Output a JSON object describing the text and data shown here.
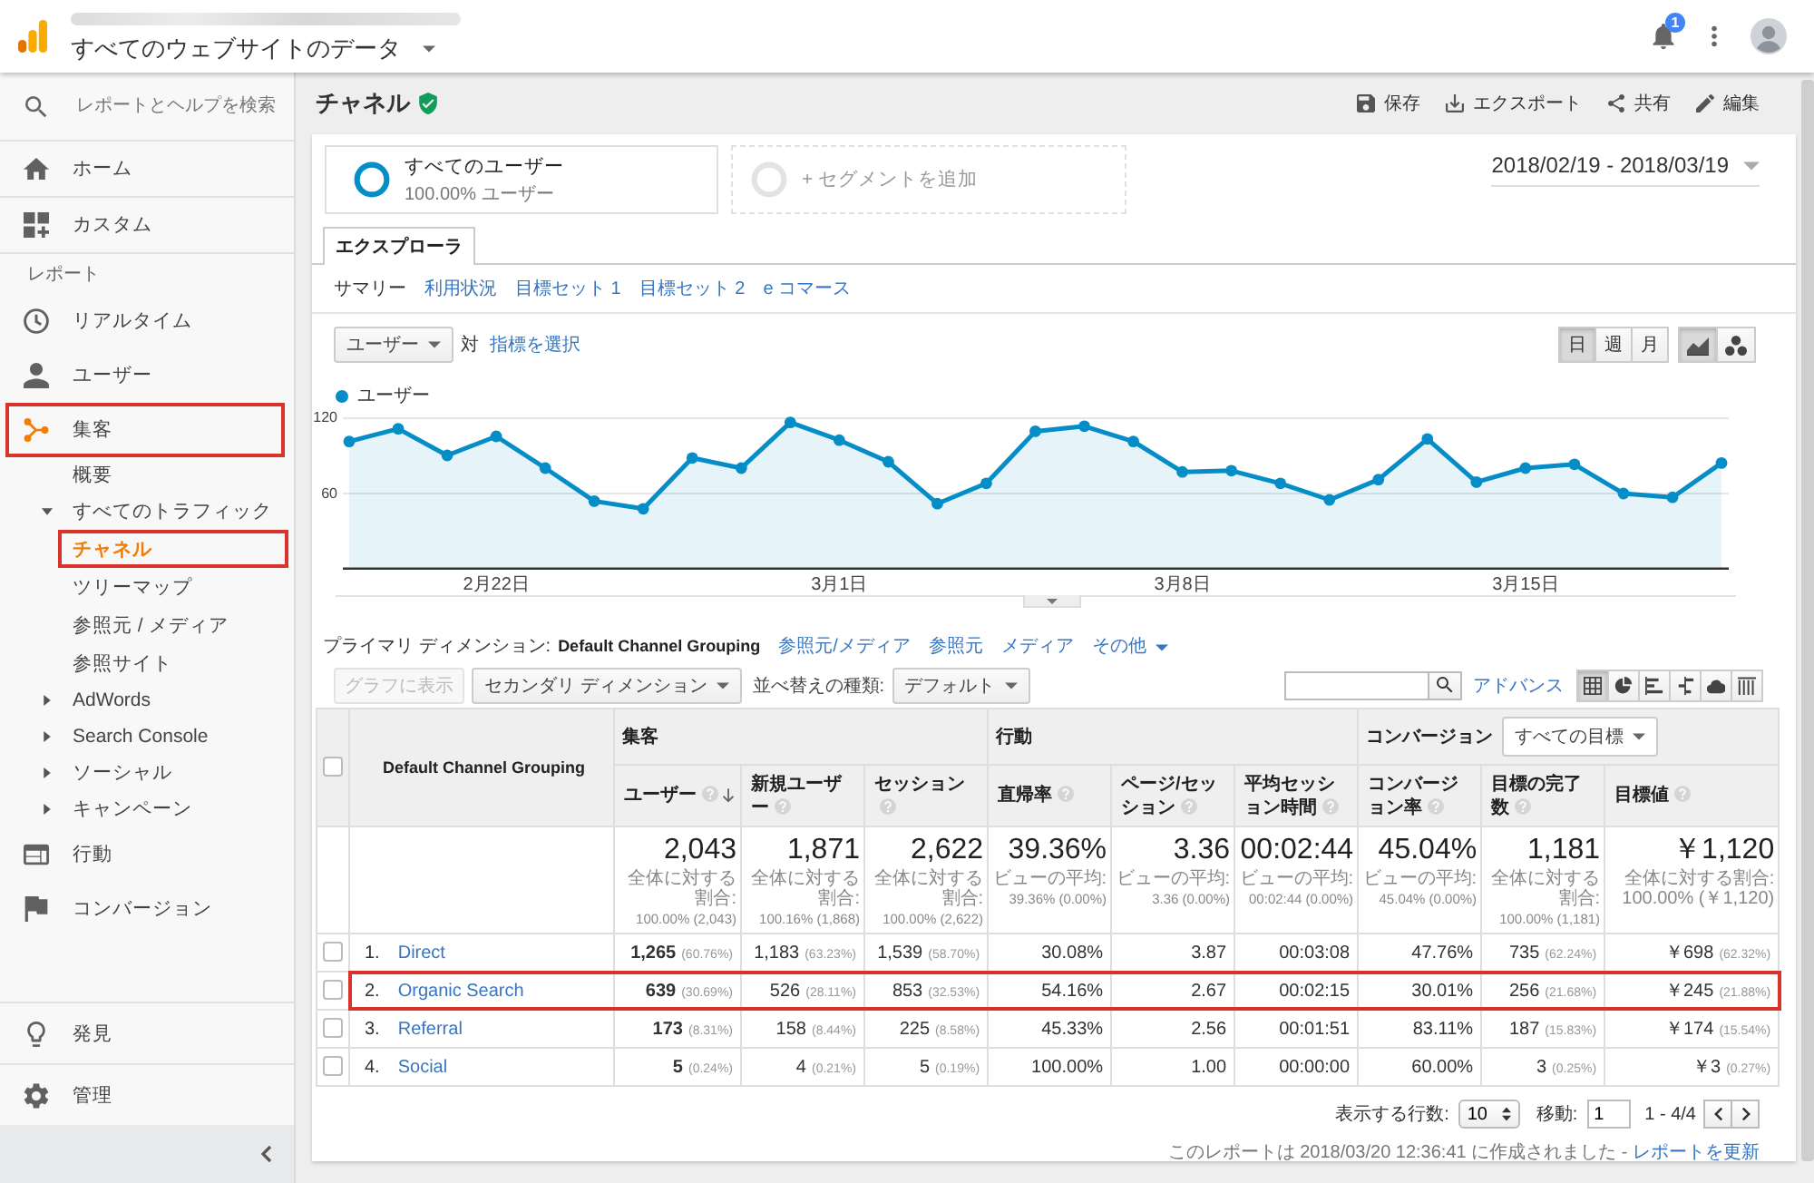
{
  "top_bar": {
    "property_title": "すべてのウェブサイトのデータ",
    "notification_count": "1"
  },
  "sidebar": {
    "search": {
      "placeholder": "レポートとヘルプを検索"
    },
    "top_items": [
      {
        "label": "ホーム",
        "selected": false
      },
      {
        "label": "カスタム",
        "selected": false
      }
    ],
    "section_label": "レポート",
    "report_items": [
      {
        "label": "リアルタイム",
        "selected": false,
        "highlighted": false
      },
      {
        "label": "ユーザー",
        "selected": false,
        "highlighted": false
      },
      {
        "label": "集客",
        "selected": true,
        "highlighted": true,
        "children": [
          {
            "label": "概要",
            "selected": false,
            "highlighted": false
          },
          {
            "label": "すべてのトラフィック",
            "selected": false,
            "highlighted": false,
            "expanded": true,
            "children": [
              {
                "label": "チャネル",
                "selected": true,
                "highlighted": true
              },
              {
                "label": "ツリーマップ",
                "selected": false,
                "highlighted": false
              },
              {
                "label": "参照元 / メディア",
                "selected": false,
                "highlighted": false
              },
              {
                "label": "参照サイト",
                "selected": false,
                "highlighted": false
              }
            ]
          },
          {
            "label": "AdWords",
            "selected": false,
            "highlighted": false,
            "expanded": false
          },
          {
            "label": "Search Console",
            "selected": false,
            "highlighted": false,
            "expanded": false
          },
          {
            "label": "ソーシャル",
            "selected": false,
            "highlighted": false,
            "expanded": false
          },
          {
            "label": "キャンペーン",
            "selected": false,
            "highlighted": false,
            "expanded": false
          }
        ]
      },
      {
        "label": "行動",
        "selected": false,
        "highlighted": false
      },
      {
        "label": "コンバージョン",
        "selected": false,
        "highlighted": false
      }
    ],
    "bottom_items": [
      {
        "label": "発見",
        "selected": false
      },
      {
        "label": "管理",
        "selected": false
      }
    ]
  },
  "page_header": {
    "title": "チャネル",
    "actions": [
      {
        "label": "保存"
      },
      {
        "label": "エクスポート"
      },
      {
        "label": "共有"
      },
      {
        "label": "編集"
      }
    ]
  },
  "segments": [
    {
      "kind": "segment",
      "label": "すべてのユーザー",
      "detail": "100.00% ユーザー"
    },
    {
      "kind": "add",
      "label": "+ セグメントを追加"
    }
  ],
  "date_range": "2018/02/19 - 2018/03/19",
  "tabs": [
    {
      "label": "エクスプローラ",
      "selected": true
    }
  ],
  "subtabs": [
    {
      "label": "サマリー",
      "selected": true
    },
    {
      "label": "利用状況",
      "selected": false
    },
    {
      "label": "目標セット 1",
      "selected": false
    },
    {
      "label": "目標セット 2",
      "selected": false
    },
    {
      "label": "e コマース",
      "selected": false
    }
  ],
  "chart_controls": {
    "metric": "ユーザー",
    "versus": "対",
    "add_metric": "指標を選択",
    "intervals": [
      {
        "label": "日",
        "selected": true
      },
      {
        "label": "週",
        "selected": false
      },
      {
        "label": "月",
        "selected": false
      }
    ],
    "chart_types": [
      {
        "selected": true
      },
      {
        "selected": false
      }
    ]
  },
  "chart": {
    "chart_data": {
      "type": "area",
      "categories": [
        null,
        null,
        null,
        "2月22日",
        null,
        null,
        null,
        null,
        null,
        null,
        "3月1日",
        null,
        null,
        null,
        null,
        null,
        null,
        "3月8日",
        null,
        null,
        null,
        null,
        null,
        null,
        "3月15日",
        null,
        null,
        null,
        null
      ],
      "series": [
        {
          "name": "ユーザー",
          "color": "#058dc7",
          "values": [
            101,
            111,
            90,
            105,
            80,
            54,
            48,
            88,
            80,
            116,
            102,
            85,
            52,
            68,
            109,
            113,
            101,
            77,
            78,
            68,
            55,
            71,
            103,
            69,
            80,
            83,
            60,
            57,
            84
          ]
        }
      ],
      "ylim": [
        0,
        120
      ],
      "yticks": [
        60,
        120
      ]
    }
  },
  "dimensions": {
    "label": "プライマリ ディメンション:",
    "current": "Default Channel Grouping",
    "options": [
      {
        "label": "参照元/メディア",
        "kind": "link"
      },
      {
        "label": "参照元",
        "kind": "link"
      },
      {
        "label": "メディア",
        "kind": "link"
      },
      {
        "label": "その他",
        "kind": "menu"
      }
    ]
  },
  "toolbar": {
    "plot_rows": {
      "label": "グラフに表示",
      "disabled": true
    },
    "secondary_dimension": "セカンダリ ディメンション",
    "sort_label": "並べ替えの種類:",
    "sort_value": "デフォルト",
    "advanced": "アドバンス",
    "views": [
      {
        "selected": true
      },
      {
        "selected": false
      },
      {
        "selected": false
      },
      {
        "selected": false
      },
      {
        "selected": false
      },
      {
        "selected": false
      }
    ]
  },
  "table": {
    "select_all_checked": false,
    "dimension_header": "Default Channel Grouping",
    "groups": [
      {
        "label": "集客",
        "columns": [
          {
            "label": "ユーザー",
            "sorted": true
          },
          {
            "label": "新規ユーザー",
            "sorted": false
          },
          {
            "label": "セッション",
            "sorted": false
          }
        ]
      },
      {
        "label": "行動",
        "columns": [
          {
            "label": "直帰率",
            "sorted": false
          },
          {
            "label": "ページ/セッション",
            "sorted": false
          },
          {
            "label": "平均セッション時間",
            "sorted": false
          }
        ]
      },
      {
        "label": "コンバージョン",
        "goal_filter": "すべての目標",
        "columns": [
          {
            "label": "コンバージョン率",
            "sorted": false
          },
          {
            "label": "目標の完了数",
            "sorted": false
          },
          {
            "label": "目標値",
            "sorted": false
          }
        ]
      }
    ],
    "totals": [
      {
        "value": "2,043",
        "caption": "全体に対する割合:",
        "detail": "100.00% (2,043)"
      },
      {
        "value": "1,871",
        "caption": "全体に対する割合:",
        "detail": "100.16% (1,868)"
      },
      {
        "value": "2,622",
        "caption": "全体に対する割合:",
        "detail": "100.00% (2,622)"
      },
      {
        "value": "39.36%",
        "caption": "ビューの平均:",
        "detail": "39.36% (0.00%)"
      },
      {
        "value": "3.36",
        "caption": "ビューの平均:",
        "detail": "3.36 (0.00%)"
      },
      {
        "value": "00:02:44",
        "caption": "ビューの平均:",
        "detail": "00:02:44 (0.00%)"
      },
      {
        "value": "45.04%",
        "caption": "ビューの平均:",
        "detail": "45.04% (0.00%)"
      },
      {
        "value": "1,181",
        "caption": "全体に対する割合:",
        "detail": "100.00% (1,181)"
      },
      {
        "value": "￥1,120",
        "caption": "全体に対する割合:",
        "detail": "100.00% (￥1,120)"
      }
    ],
    "rows": [
      {
        "number": "1.",
        "name": "Direct",
        "checked": false,
        "highlighted": false,
        "cells": [
          {
            "value": "1,265",
            "share": "(60.76%)"
          },
          {
            "value": "1,183",
            "share": "(63.23%)"
          },
          {
            "value": "1,539",
            "share": "(58.70%)"
          },
          {
            "value": "30.08%"
          },
          {
            "value": "3.87"
          },
          {
            "value": "00:03:08"
          },
          {
            "value": "47.76%"
          },
          {
            "value": "735",
            "share": "(62.24%)"
          },
          {
            "value": "￥698",
            "share": "(62.32%)"
          }
        ]
      },
      {
        "number": "2.",
        "name": "Organic Search",
        "checked": false,
        "highlighted": true,
        "cells": [
          {
            "value": "639",
            "share": "(30.69%)"
          },
          {
            "value": "526",
            "share": "(28.11%)"
          },
          {
            "value": "853",
            "share": "(32.53%)"
          },
          {
            "value": "54.16%"
          },
          {
            "value": "2.67"
          },
          {
            "value": "00:02:15"
          },
          {
            "value": "30.01%"
          },
          {
            "value": "256",
            "share": "(21.68%)"
          },
          {
            "value": "￥245",
            "share": "(21.88%)"
          }
        ]
      },
      {
        "number": "3.",
        "name": "Referral",
        "checked": false,
        "highlighted": false,
        "cells": [
          {
            "value": "173",
            "share": "(8.31%)"
          },
          {
            "value": "158",
            "share": "(8.44%)"
          },
          {
            "value": "225",
            "share": "(8.58%)"
          },
          {
            "value": "45.33%"
          },
          {
            "value": "2.56"
          },
          {
            "value": "00:01:51"
          },
          {
            "value": "83.11%"
          },
          {
            "value": "187",
            "share": "(15.83%)"
          },
          {
            "value": "￥174",
            "share": "(15.54%)"
          }
        ]
      },
      {
        "number": "4.",
        "name": "Social",
        "checked": false,
        "highlighted": false,
        "cells": [
          {
            "value": "5",
            "share": "(0.24%)"
          },
          {
            "value": "4",
            "share": "(0.21%)"
          },
          {
            "value": "5",
            "share": "(0.19%)"
          },
          {
            "value": "100.00%"
          },
          {
            "value": "1.00"
          },
          {
            "value": "00:00:00"
          },
          {
            "value": "60.00%"
          },
          {
            "value": "3",
            "share": "(0.25%)"
          },
          {
            "value": "￥3",
            "share": "(0.27%)"
          }
        ]
      }
    ]
  },
  "footer": {
    "rows_label": "表示する行数:",
    "rows_value": "10",
    "goto_label": "移動:",
    "goto_value": "1",
    "range": "1 - 4/4",
    "report_note": "このレポートは 2018/03/20 12:36:41 に作成されました - ",
    "refresh_link": "レポートを更新"
  }
}
